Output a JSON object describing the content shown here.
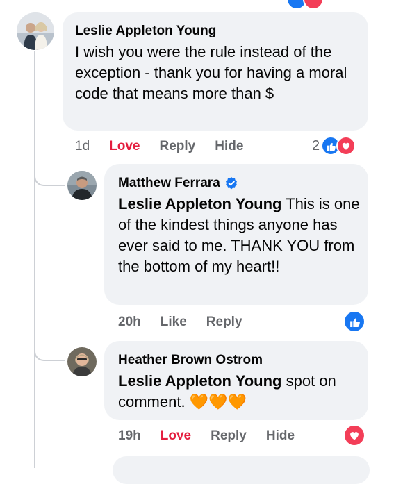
{
  "comments": [
    {
      "author": "Leslie Appleton Young",
      "text": "I wish you were the rule instead of the exception - thank you for having a moral code that means more than $",
      "time": "1d",
      "love_label": "Love",
      "reply_label": "Reply",
      "hide_label": "Hide",
      "reaction_count": "2"
    },
    {
      "author": "Matthew Ferrara",
      "verified": true,
      "mention": "Leslie Appleton Young",
      "text": "This is one of the kindest things anyone has ever said to me. THANK YOU from the bottom of my heart!!",
      "time": "20h",
      "like_label": "Like",
      "reply_label": "Reply"
    },
    {
      "author": "Heather Brown Ostrom",
      "mention": "Leslie Appleton Young",
      "text": "spot on comment.",
      "emoji": "🧡🧡🧡",
      "time": "19h",
      "love_label": "Love",
      "reply_label": "Reply",
      "hide_label": "Hide"
    }
  ],
  "colors": {
    "like_blue": "#1877f2",
    "love_red": "#e41e3f",
    "heart_pink": "#f33e58",
    "bubble_gray": "#f0f2f5",
    "meta_gray": "#65676b"
  },
  "icons": [
    "like-icon",
    "love-icon",
    "verified-badge-icon",
    "orange-heart-emoji"
  ]
}
